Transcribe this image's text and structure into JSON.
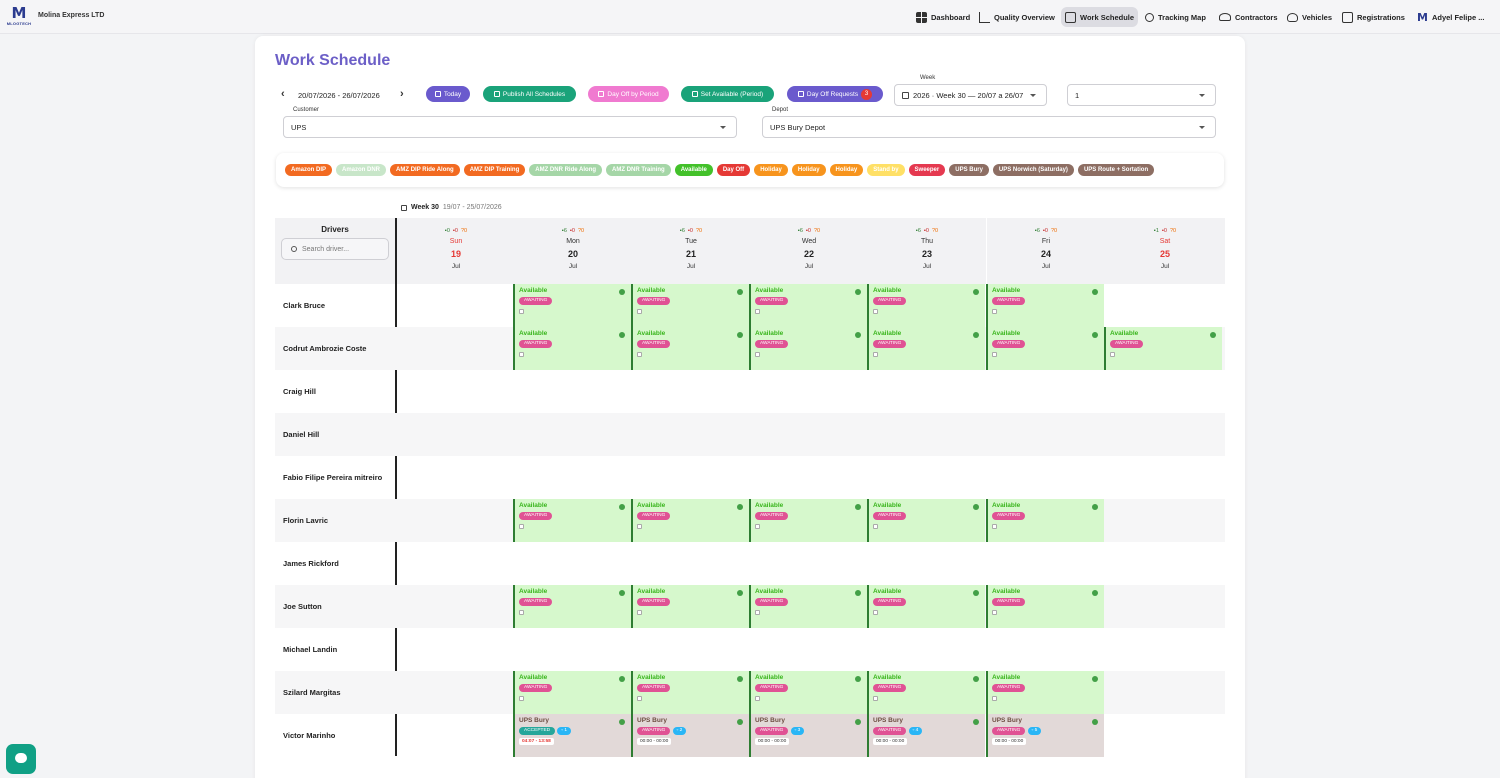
{
  "topbar": {
    "logo_mark": "M",
    "logo_text": "MLOGTECH",
    "company": "Molina Express LTD",
    "nav": [
      {
        "label": "Dashboard",
        "icon": "dashboard-icon"
      },
      {
        "label": "Quality Overview",
        "icon": "chart-icon"
      },
      {
        "label": "Work Schedule",
        "icon": "calendar-icon",
        "active": true
      },
      {
        "label": "Tracking Map",
        "icon": "route-icon"
      },
      {
        "label": "Contractors",
        "icon": "people-icon"
      },
      {
        "label": "Vehicles",
        "icon": "car-icon"
      },
      {
        "label": "Registrations",
        "icon": "list-icon"
      }
    ],
    "user": "Adyel Felipe ..."
  },
  "page": {
    "title": "Work Schedule"
  },
  "toolbar": {
    "date_range": "20/07/2026 - 26/07/2026",
    "today": "Today",
    "publish": "Publish All Schedules",
    "day_off_period": "Day Off by Period",
    "set_available": "Set Available (Period)",
    "day_off_requests": "Day Off Requests",
    "requests_count": "3",
    "week_label": "Week",
    "week_value": "2026 · Week 30 — 20/07 a 26/07",
    "count_value": "1",
    "customer_label": "Customer",
    "customer_value": "UPS",
    "depot_label": "Depot",
    "depot_value": "UPS Bury Depot"
  },
  "legend": [
    {
      "label": "Amazon DIP",
      "color": "#f26a21"
    },
    {
      "label": "Amazon DNR",
      "color": "#c8e6c9"
    },
    {
      "label": "AMZ DIP Ride Along",
      "color": "#f26a21"
    },
    {
      "label": "AMZ DIP Training",
      "color": "#f26a21"
    },
    {
      "label": "AMZ DNR Ride Along",
      "color": "#a5d6a7"
    },
    {
      "label": "AMZ DNR Training",
      "color": "#a5d6a7"
    },
    {
      "label": "Available",
      "color": "#43c12a"
    },
    {
      "label": "Day Off",
      "color": "#e53935"
    },
    {
      "label": "Holiday",
      "color": "#f7941d"
    },
    {
      "label": "Holiday",
      "color": "#f7941d"
    },
    {
      "label": "Holiday",
      "color": "#f7941d"
    },
    {
      "label": "Stand by",
      "color": "#ffe066"
    },
    {
      "label": "Sweeper",
      "color": "#e53950"
    },
    {
      "label": "UPS Bury",
      "color": "#8d6e63"
    },
    {
      "label": "UPS Norwich (Saturday)",
      "color": "#8d6e63"
    },
    {
      "label": "UPS Route + Sortation",
      "color": "#8d6e63"
    }
  ],
  "calendar": {
    "week_title": "Week 30",
    "week_range": "19/07 - 25/07/2026",
    "drivers_title": "Drivers",
    "search_placeholder": "Search driver...",
    "days": [
      {
        "name": "Sun",
        "num": "19",
        "mon": "Jul",
        "g": "0",
        "r": "0",
        "o": "0",
        "weekend": true
      },
      {
        "name": "Mon",
        "num": "20",
        "mon": "Jul",
        "g": "6",
        "r": "0",
        "o": "0"
      },
      {
        "name": "Tue",
        "num": "21",
        "mon": "Jul",
        "g": "6",
        "r": "0",
        "o": "0"
      },
      {
        "name": "Wed",
        "num": "22",
        "mon": "Jul",
        "g": "6",
        "r": "0",
        "o": "0"
      },
      {
        "name": "Thu",
        "num": "23",
        "mon": "Jul",
        "g": "6",
        "r": "0",
        "o": "0"
      },
      {
        "name": "Fri",
        "num": "24",
        "mon": "Jul",
        "g": "6",
        "r": "0",
        "o": "0"
      },
      {
        "name": "Sat",
        "num": "25",
        "mon": "Jul",
        "g": "1",
        "r": "0",
        "o": "0",
        "weekend": true
      }
    ],
    "drivers": [
      {
        "name": "Clark Bruce",
        "cells": [
          null,
          "A",
          "A",
          "A",
          "A",
          "A",
          null
        ]
      },
      {
        "name": "Codrut Ambrozie Coste",
        "cells": [
          null,
          "A",
          "A",
          "A",
          "A",
          "A",
          "A"
        ]
      },
      {
        "name": "Craig Hill",
        "cells": [
          null,
          null,
          null,
          null,
          null,
          null,
          null
        ]
      },
      {
        "name": "Daniel Hill",
        "cells": [
          null,
          null,
          null,
          null,
          null,
          null,
          null
        ]
      },
      {
        "name": "Fabio Filipe Pereira mitreiro",
        "cells": [
          null,
          null,
          null,
          null,
          null,
          null,
          null
        ]
      },
      {
        "name": "Florin Lavric",
        "cells": [
          null,
          "A",
          "A",
          "A",
          "A",
          "A",
          null
        ]
      },
      {
        "name": "James Rickford",
        "cells": [
          null,
          null,
          null,
          null,
          null,
          null,
          null
        ]
      },
      {
        "name": "Joe Sutton",
        "cells": [
          null,
          "A",
          "A",
          "A",
          "A",
          "A",
          null
        ]
      },
      {
        "name": "Michael Landin",
        "cells": [
          null,
          null,
          null,
          null,
          null,
          null,
          null
        ]
      },
      {
        "name": "Szilard Margitas",
        "cells": [
          null,
          "A",
          "A",
          "A",
          "A",
          "A",
          null
        ]
      },
      {
        "name": "Victor Marinho",
        "cells": [
          null,
          "B1",
          "B2",
          "B3",
          "B4",
          "B5",
          null
        ]
      }
    ],
    "labels": {
      "available": "Available",
      "awaiting": "AWAITING",
      "accepted": "ACCEPTED",
      "ups_bury": "UPS Bury"
    },
    "bury_cells": {
      "B1": {
        "status": "ACCEPTED",
        "count": "1",
        "time": "04:07 - 13:58",
        "red": true
      },
      "B2": {
        "status": "AWAITING",
        "count": "2",
        "time": "00:00 - 00:00"
      },
      "B3": {
        "status": "AWAITING",
        "count": "3",
        "time": "00:00 - 00:00"
      },
      "B4": {
        "status": "AWAITING",
        "count": "4",
        "time": "00:00 - 00:00"
      },
      "B5": {
        "status": "AWAITING",
        "count": "5",
        "time": "00:00 - 00:00"
      }
    }
  }
}
